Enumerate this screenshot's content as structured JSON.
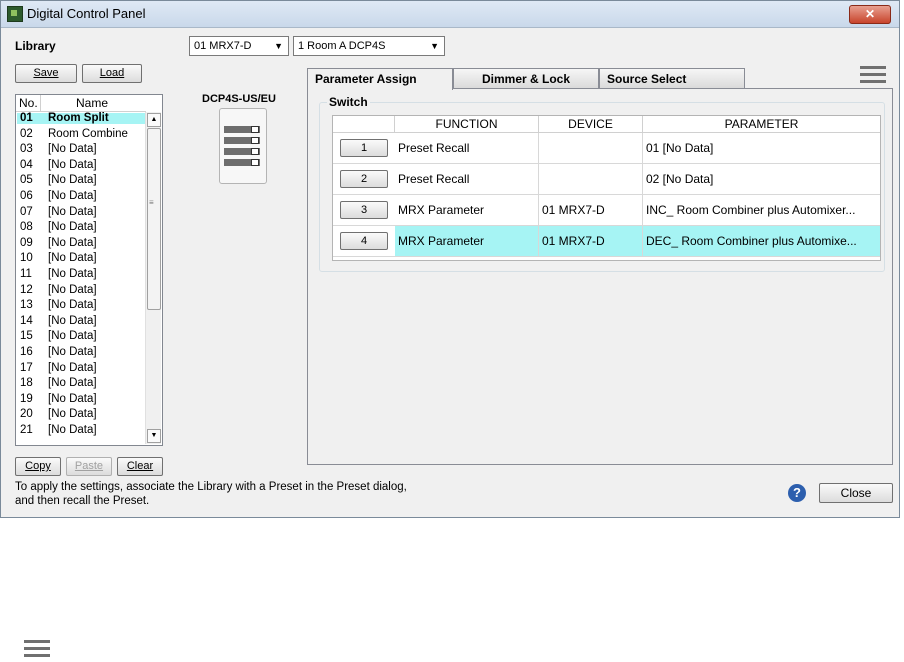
{
  "window": {
    "title": "Digital Control Panel"
  },
  "library": {
    "label": "Library",
    "save_label": "Save",
    "load_label": "Load",
    "col_no": "No.",
    "col_name": "Name",
    "items": [
      {
        "no": "01",
        "name": "Room Split"
      },
      {
        "no": "02",
        "name": "Room Combine"
      },
      {
        "no": "03",
        "name": "[No Data]"
      },
      {
        "no": "04",
        "name": "[No Data]"
      },
      {
        "no": "05",
        "name": "[No Data]"
      },
      {
        "no": "06",
        "name": "[No Data]"
      },
      {
        "no": "07",
        "name": "[No Data]"
      },
      {
        "no": "08",
        "name": "[No Data]"
      },
      {
        "no": "09",
        "name": "[No Data]"
      },
      {
        "no": "10",
        "name": "[No Data]"
      },
      {
        "no": "11",
        "name": "[No Data]"
      },
      {
        "no": "12",
        "name": "[No Data]"
      },
      {
        "no": "13",
        "name": "[No Data]"
      },
      {
        "no": "14",
        "name": "[No Data]"
      },
      {
        "no": "15",
        "name": "[No Data]"
      },
      {
        "no": "16",
        "name": "[No Data]"
      },
      {
        "no": "17",
        "name": "[No Data]"
      },
      {
        "no": "18",
        "name": "[No Data]"
      },
      {
        "no": "19",
        "name": "[No Data]"
      },
      {
        "no": "20",
        "name": "[No Data]"
      },
      {
        "no": "21",
        "name": "[No Data]"
      }
    ],
    "selected_no": "01",
    "copy_label": "Copy",
    "paste_label": "Paste",
    "clear_label": "Clear"
  },
  "selectors": {
    "device": "01 MRX7-D",
    "dcp": "1 Room A DCP4S"
  },
  "device_model": "DCP4S-US/EU",
  "tabs": [
    "Parameter Assign",
    "Dimmer & Lock",
    "Source Select"
  ],
  "active_tab": "Parameter Assign",
  "switch_group": {
    "label": "Switch",
    "headers": {
      "function": "FUNCTION",
      "device": "DEVICE",
      "parameter": "PARAMETER"
    },
    "rows": [
      {
        "num": "1",
        "function": "Preset Recall",
        "device": "",
        "parameter": "01 [No Data]"
      },
      {
        "num": "2",
        "function": "Preset Recall",
        "device": "",
        "parameter": "02 [No Data]"
      },
      {
        "num": "3",
        "function": "MRX Parameter",
        "device": "01 MRX7-D",
        "parameter": "INC_ Room Combiner plus Automixer..."
      },
      {
        "num": "4",
        "function": "MRX Parameter",
        "device": "01 MRX7-D",
        "parameter": "DEC_ Room Combiner plus Automixe..."
      }
    ],
    "selected_row": "4"
  },
  "footer": {
    "hint_line1": "To apply the settings, associate the Library with a Preset in the Preset dialog,",
    "hint_line2": "and then recall the Preset.",
    "close_label": "Close"
  },
  "icons": {
    "menu": "hamburger-menu-icon",
    "help": "help-icon",
    "window_close": "close-icon"
  },
  "colors": {
    "selection": "#a6f4f4",
    "help": "#2d5fae",
    "close_button": "#c8442c"
  }
}
